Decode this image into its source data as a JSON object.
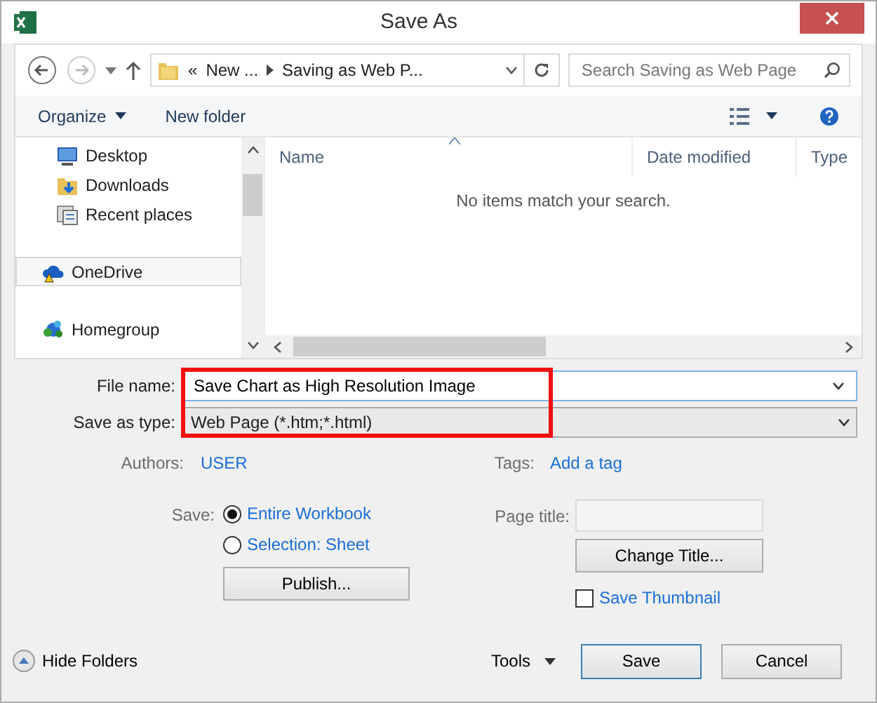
{
  "window": {
    "title": "Save As"
  },
  "address": {
    "overflow": "«",
    "crumbs": [
      "New ...",
      "Saving as Web P..."
    ]
  },
  "search": {
    "placeholder": "Search Saving as Web Page"
  },
  "toolbar": [
    {
      "label": "Organize",
      "kind": "menu"
    },
    {
      "label": "New folder",
      "kind": "button"
    }
  ],
  "sidebar": {
    "items": [
      {
        "label": "Desktop",
        "selected": false
      },
      {
        "label": "Downloads",
        "selected": false
      },
      {
        "label": "Recent places",
        "selected": false
      },
      {
        "label": "OneDrive",
        "selected": true
      },
      {
        "label": "Homegroup",
        "selected": false
      }
    ]
  },
  "file_list": {
    "columns": [
      {
        "label": "Name",
        "sorted": true
      },
      {
        "label": "Date modified",
        "sorted": false
      },
      {
        "label": "Type",
        "sorted": false
      }
    ],
    "empty_message": "No items match your search."
  },
  "form": {
    "highlighted": true,
    "file_name": {
      "label": "File name:",
      "value": "Save Chart as High Resolution Image"
    },
    "save_as_type": {
      "label": "Save as type:",
      "value": "Web Page (*.htm;*.html)"
    },
    "authors": {
      "label": "Authors:",
      "value": "USER"
    },
    "tags": {
      "label": "Tags:",
      "value": "Add a tag"
    },
    "save": {
      "label": "Save:",
      "options": [
        {
          "label": "Entire Workbook",
          "selected": true
        },
        {
          "label": "Selection: Sheet",
          "selected": false
        }
      ]
    },
    "publish_button": "Publish...",
    "page_title": {
      "label": "Page title:"
    },
    "change_title_button": "Change Title...",
    "save_thumbnail": {
      "label": "Save Thumbnail",
      "checked": false
    }
  },
  "footer": {
    "hide_folders": "Hide Folders",
    "tools": "Tools",
    "save": "Save",
    "cancel": "Cancel"
  }
}
